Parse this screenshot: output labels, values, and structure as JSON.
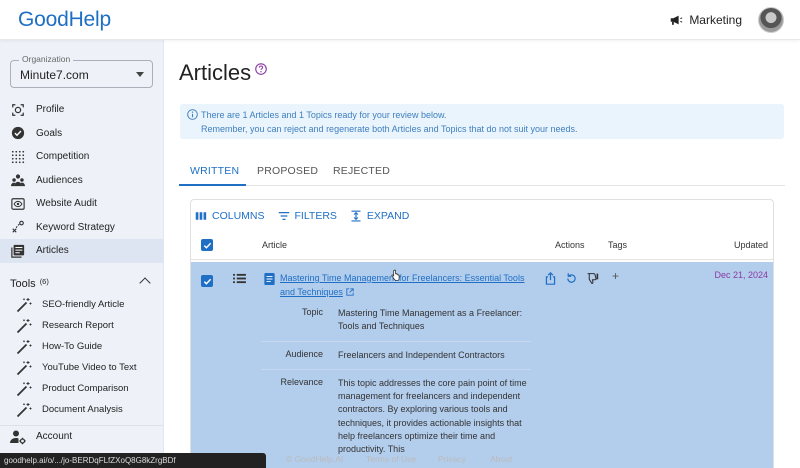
{
  "app": {
    "logo": "GoodHelp",
    "workspace": "Marketing"
  },
  "sidebar": {
    "org_label": "Organization",
    "org_value": "Minute7.com",
    "items": [
      {
        "label": "Profile",
        "icon": "target-icon"
      },
      {
        "label": "Goals",
        "icon": "check-circle-icon"
      },
      {
        "label": "Competition",
        "icon": "dots-grid-icon"
      },
      {
        "label": "Audiences",
        "icon": "people-icon"
      },
      {
        "label": "Website Audit",
        "icon": "eye-icon"
      },
      {
        "label": "Keyword Strategy",
        "icon": "key-strategy-icon"
      },
      {
        "label": "Articles",
        "icon": "articles-icon",
        "active": true
      }
    ],
    "tools_label": "Tools",
    "tools_count": "(6)",
    "tools": [
      "SEO-friendly Article",
      "Research Report",
      "How-To Guide",
      "YouTube Video to Text",
      "Product Comparison",
      "Document Analysis"
    ],
    "account": "Account"
  },
  "main": {
    "title": "Articles",
    "alert_line1": "There are 1 Articles and 1 Topics ready for your review below.",
    "alert_line2": "Remember, you can reject and regenerate both Articles and Topics that do not suit your needs.",
    "tabs": [
      "WRITTEN",
      "PROPOSED",
      "REJECTED"
    ],
    "toolbar": {
      "columns": "COLUMNS",
      "filters": "FILTERS",
      "expand": "EXPAND"
    },
    "headers": {
      "article": "Article",
      "actions": "Actions",
      "tags": "Tags",
      "updated": "Updated"
    },
    "row": {
      "title": "Mastering Time Management for Freelancers: Essential Tools and Techniques",
      "date": "Dec 21, 2024",
      "tag_add": "+",
      "details": [
        {
          "key": "Topic",
          "value": "Mastering Time Management as a Freelancer: Tools and Techniques"
        },
        {
          "key": "Audience",
          "value": "Freelancers and Independent Contractors"
        },
        {
          "key": "Relevance",
          "value": "This topic addresses the core pain point of time management for freelancers and independent contractors. By exploring various tools and techniques, it provides actionable insights that help freelancers optimize their time and productivity. This"
        }
      ]
    }
  },
  "footer": {
    "copyright": "© GoodHelp.AI",
    "terms": "Terms of Use",
    "privacy": "Privacy",
    "about": "About"
  },
  "statusbar": "goodhelp.ai/o/.../jo-BERDqFLfZXoQ8G8kZrgBDf",
  "colors": {
    "accent": "#1f6fc5",
    "row_selected": "#b3cdec",
    "date": "#8a3aa0"
  }
}
